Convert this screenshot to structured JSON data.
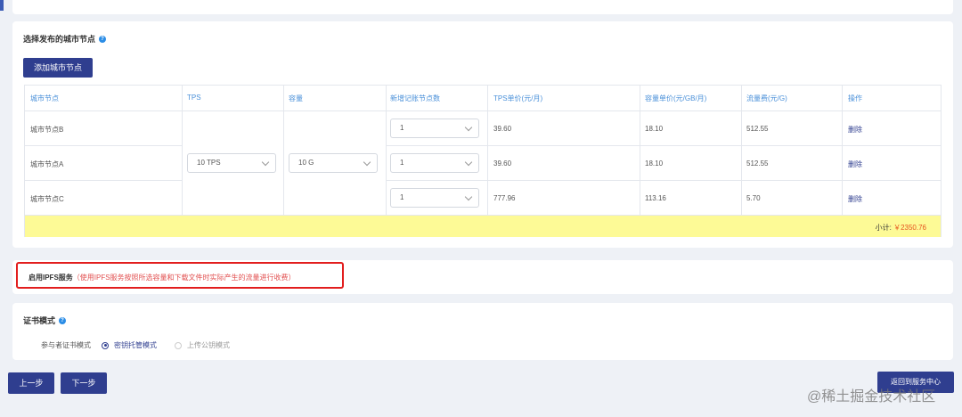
{
  "nodes_section": {
    "title": "选择发布的城市节点",
    "help_icon": "help-icon",
    "add_button": "添加城市节点"
  },
  "table": {
    "headers": [
      "城市节点",
      "TPS",
      "容量",
      "新增记账节点数",
      "TPS单价(元/月)",
      "容量单价(元/GB/月)",
      "流量费(元/G)",
      "操作"
    ],
    "rows": [
      {
        "node": "城市节点B",
        "count": "1",
        "tps_price": "39.60",
        "capacity_price": "18.10",
        "traffic_fee": "512.55",
        "action": "删除"
      },
      {
        "node": "城市节点A",
        "count": "1",
        "tps_price": "39.60",
        "capacity_price": "18.10",
        "traffic_fee": "512.55",
        "action": "删除"
      },
      {
        "node": "城市节点C",
        "count": "1",
        "tps_price": "777.96",
        "capacity_price": "113.16",
        "traffic_fee": "5.70",
        "action": "删除"
      }
    ],
    "tps_value": "10 TPS",
    "capacity_value": "10 G",
    "subtotal_label": "小计:",
    "subtotal_value": "￥2350.76"
  },
  "ipfs": {
    "label": "启用IPFS服务",
    "note": "（使用IPFS服务按照所选容量和下载文件时实际产生的流量进行收费）"
  },
  "cert": {
    "title": "证书模式",
    "row_label": "参与者证书模式",
    "options": [
      "密钥托管模式",
      "上传公钥模式"
    ],
    "selected": "密钥托管模式"
  },
  "footer": {
    "prev": "上一步",
    "next": "下一步",
    "back": "返回到服务中心"
  },
  "watermark": "@稀土掘金技术社区",
  "colors": {
    "primary": "#2f3e8f",
    "header_text": "#4a90d9",
    "subtotal_bg": "#fdfa96",
    "price_red": "#e6531e",
    "highlight_border": "#e21e1e"
  }
}
